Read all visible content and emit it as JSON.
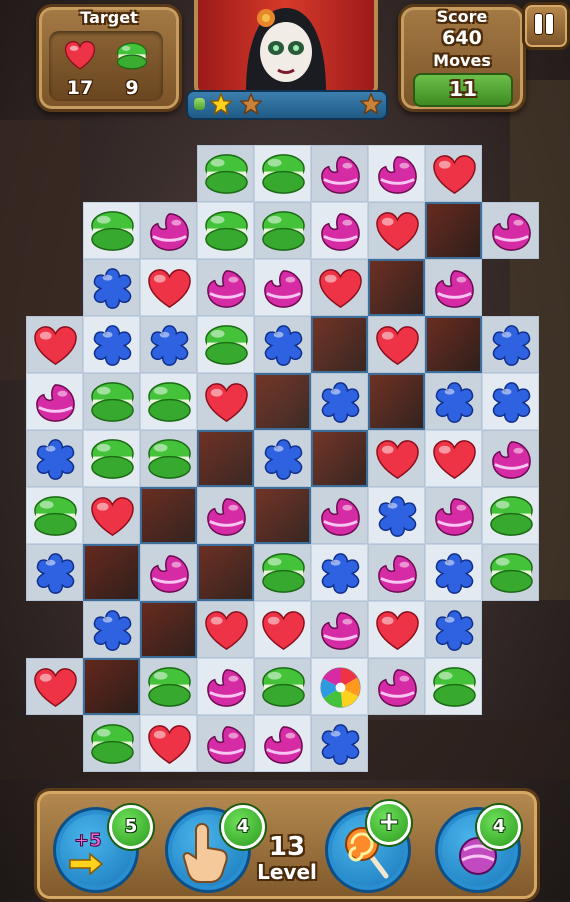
{
  "hud": {
    "target_title": "Target",
    "targets": [
      {
        "candy": "heart",
        "icon": "red-heart-candy-icon",
        "count": "17"
      },
      {
        "candy": "macaron",
        "icon": "green-macaron-candy-icon",
        "count": "9"
      }
    ],
    "score_label": "Score",
    "score_value": "640",
    "moves_label": "Moves",
    "moves_value": "11",
    "progress_fraction": 0.06,
    "stars": [
      {
        "icon": "star-filled-icon",
        "filled": true
      },
      {
        "icon": "star-empty-icon",
        "filled": false
      },
      {
        "icon": "star-empty-icon",
        "filled": false
      }
    ],
    "pause_icon": "pause-icon",
    "portrait_icon": "character-portrait"
  },
  "board": {
    "columns": 9,
    "rows": 11,
    "legend": {
      "G": "green macaron",
      "P": "purple drop",
      "R": "red heart",
      "B": "blue flower",
      "C": "rainbow color bomb",
      "x": "empty hole",
      ".": "no cell"
    },
    "grid": [
      "...GGPPR.",
      ".GPGGPRxP",
      ".BRPPRxP.",
      "RBBGBxRxB",
      "PGGRxBxBB",
      "BGGxBxRRP",
      "GRxPxPBPG",
      "BxPxGBPBG",
      ".BxRRPRB.",
      "RxGPGCPG.",
      ".GRPPB..."
    ],
    "colors": {
      "G": "#43c23a",
      "P": "#d52ba4",
      "R": "#ef3346",
      "B": "#2f62e0",
      "C": "#ffffff"
    }
  },
  "bottom_bar": {
    "boosters": [
      {
        "name": "extra-moves-booster",
        "icon": "plus-five-moves-icon",
        "badge": "5"
      },
      {
        "name": "hand-swap-booster",
        "icon": "pointing-hand-icon",
        "badge": "4"
      },
      {
        "name": "lollipop-hammer-booster",
        "icon": "lollipop-icon",
        "badge": "+"
      },
      {
        "name": "bomb-booster",
        "icon": "candy-bomb-icon",
        "badge": "4"
      }
    ],
    "level_value": "13",
    "level_label": "Level"
  }
}
